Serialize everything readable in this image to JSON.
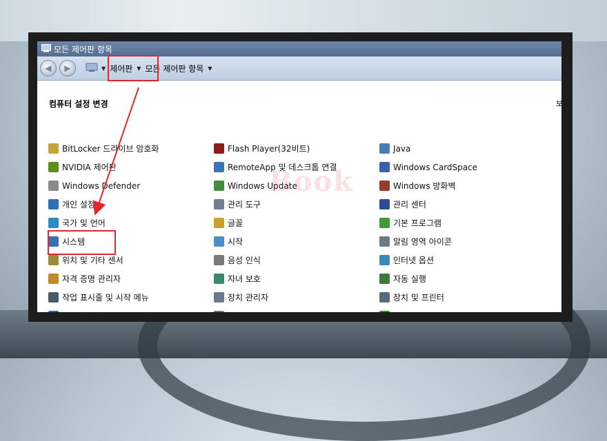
{
  "window": {
    "title": "모든 제어판 항목"
  },
  "breadcrumb": {
    "root": "제어판",
    "current": "모든 제어판 항목"
  },
  "section_title": "컴퓨터 설정 변경",
  "side_text": "보",
  "watermark": "Book",
  "items": [
    {
      "label": "BitLocker 드라이브 암호화",
      "icon": "bitlocker-icon",
      "color": "#c8a23a"
    },
    {
      "label": "Flash Player(32비트)",
      "icon": "flash-icon",
      "color": "#8a1c1c"
    },
    {
      "label": "Java",
      "icon": "java-icon",
      "color": "#4b7db5"
    },
    {
      "label": "NVIDIA 제어판",
      "icon": "nvidia-icon",
      "color": "#5a8f1c"
    },
    {
      "label": "RemoteApp 및 데스크톱 연결",
      "icon": "remoteapp-icon",
      "color": "#3a74b8"
    },
    {
      "label": "Windows CardSpace",
      "icon": "cardspace-icon",
      "color": "#3a5fa8"
    },
    {
      "label": "Windows Defender",
      "icon": "defender-icon",
      "color": "#8a8a8a"
    },
    {
      "label": "Windows Update",
      "icon": "windows-update-icon",
      "color": "#3f8f3c"
    },
    {
      "label": "Windows 방화벽",
      "icon": "firewall-icon",
      "color": "#9a3a2a"
    },
    {
      "label": "개인 설정",
      "icon": "personalize-icon",
      "color": "#2f6fb5"
    },
    {
      "label": "관리 도구",
      "icon": "admin-tools-icon",
      "color": "#6d7f91"
    },
    {
      "label": "관리 센터",
      "icon": "action-center-icon",
      "color": "#2a4f9a"
    },
    {
      "label": "국가 및 언어",
      "icon": "region-icon",
      "color": "#2d8cc4"
    },
    {
      "label": "글꼴",
      "icon": "fonts-icon",
      "color": "#c9a12c"
    },
    {
      "label": "기본 프로그램",
      "icon": "default-programs-icon",
      "color": "#3f9a3a"
    },
    {
      "label": "시스템",
      "icon": "system-icon",
      "color": "#3a6fb0"
    },
    {
      "label": "시작",
      "icon": "getting-started-icon",
      "color": "#4a90c8"
    },
    {
      "label": "알림 영역 아이콘",
      "icon": "notification-icon",
      "color": "#6b7a88"
    },
    {
      "label": "위치 및 기타 센서",
      "icon": "sensor-icon",
      "color": "#9a8a3a"
    },
    {
      "label": "음성 인식",
      "icon": "speech-icon",
      "color": "#7a7a7a"
    },
    {
      "label": "인터넷 옵션",
      "icon": "internet-options-icon",
      "color": "#3a8ab8"
    },
    {
      "label": "자격 증명 관리자",
      "icon": "credential-icon",
      "color": "#c08a2a"
    },
    {
      "label": "자녀 보호",
      "icon": "parental-icon",
      "color": "#3a8a6a"
    },
    {
      "label": "자동 실행",
      "icon": "autoplay-icon",
      "color": "#3a7a3a"
    },
    {
      "label": "작업 표시줄 및 시작 메뉴",
      "icon": "taskbar-icon",
      "color": "#4a5a6a"
    },
    {
      "label": "장치 관리자",
      "icon": "device-manager-icon",
      "color": "#6a7a8a"
    },
    {
      "label": "장치 및 프린터",
      "icon": "printer-icon",
      "color": "#5a6a7a"
    },
    {
      "label": "접근성 센터",
      "icon": "ease-access-icon",
      "color": "#2a6ab0"
    },
    {
      "label": "전화 및 모뎀",
      "icon": "phone-icon",
      "color": "#6a7a8a"
    },
    {
      "label": "전원 옵션",
      "icon": "power-icon",
      "color": "#3a8a3a"
    }
  ]
}
